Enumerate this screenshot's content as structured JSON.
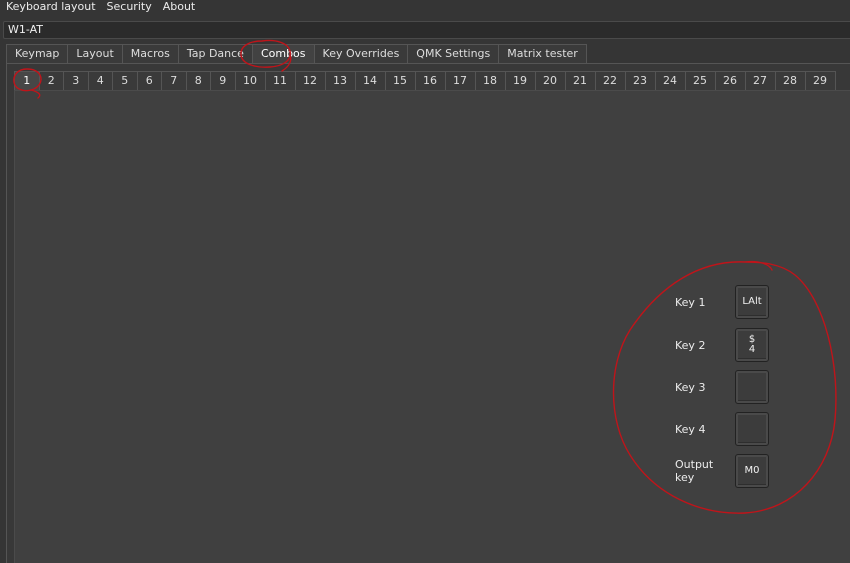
{
  "menu": {
    "items": [
      "Keyboard layout",
      "Security",
      "About"
    ]
  },
  "keyboard_select": {
    "value": "W1-AT"
  },
  "tabs": [
    {
      "label": "Keymap"
    },
    {
      "label": "Layout"
    },
    {
      "label": "Macros"
    },
    {
      "label": "Tap Dance"
    },
    {
      "label": "Combos",
      "active": true
    },
    {
      "label": "Key Overrides"
    },
    {
      "label": "QMK Settings"
    },
    {
      "label": "Matrix tester"
    }
  ],
  "combo_tabs": [
    "1",
    "2",
    "3",
    "4",
    "5",
    "6",
    "7",
    "8",
    "9",
    "10",
    "11",
    "12",
    "13",
    "14",
    "15",
    "16",
    "17",
    "18",
    "19",
    "20",
    "21",
    "22",
    "23",
    "24",
    "25",
    "26",
    "27",
    "28",
    "29"
  ],
  "combo_active": "1",
  "combo": {
    "key1": {
      "label": "Key 1",
      "value": "LAlt"
    },
    "key2": {
      "label": "Key 2",
      "value_top": "$",
      "value_bottom": "4"
    },
    "key3": {
      "label": "Key 3",
      "value": ""
    },
    "key4": {
      "label": "Key 4",
      "value": ""
    },
    "output": {
      "label": "Output key",
      "value": "M0"
    }
  },
  "colors": {
    "background": "#353535",
    "annotation": "#c0141a"
  }
}
